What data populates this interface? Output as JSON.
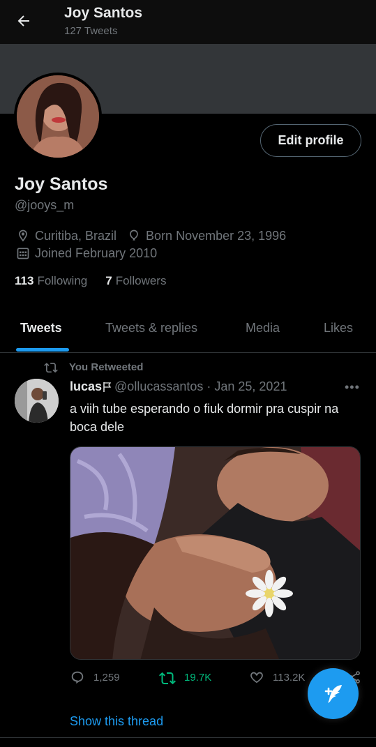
{
  "header": {
    "title": "Joy Santos",
    "tweet_count": "127 Tweets"
  },
  "profile": {
    "name": "Joy Santos",
    "handle": "@jooys_m",
    "location": "Curitiba, Brazil",
    "birthday": "Born November 23, 1996",
    "joined": "Joined February 2010",
    "following_count": "113",
    "following_label": "Following",
    "followers_count": "7",
    "followers_label": "Followers",
    "edit_profile_label": "Edit profile"
  },
  "tabs": [
    {
      "label": "Tweets",
      "active": true
    },
    {
      "label": "Tweets & replies",
      "active": false
    },
    {
      "label": "Media",
      "active": false
    },
    {
      "label": "Likes",
      "active": false
    }
  ],
  "tweet": {
    "retweet_context": "You Retweeted",
    "author_name": "lucas",
    "author_handle": "@ollucassantos",
    "separator": "·",
    "date": "Jan 25, 2021",
    "text": "a viih tube esperando o fiuk dormir pra cuspir na boca dele",
    "replies": "1,259",
    "retweets": "19.7K",
    "likes": "113.2K",
    "show_thread": "Show this thread"
  },
  "colors": {
    "accent": "#1d9bf0",
    "retweet_green": "#00ba7c",
    "muted_text": "#71767b",
    "background": "#000000"
  },
  "icons": {
    "back": "arrow-left-icon",
    "location": "location-pin-icon",
    "birthday": "balloon-icon",
    "joined": "calendar-icon",
    "retweet": "retweet-icon",
    "reply": "reply-icon",
    "like": "heart-icon",
    "share": "share-icon",
    "more": "more-icon",
    "compose": "compose-feather-icon"
  }
}
